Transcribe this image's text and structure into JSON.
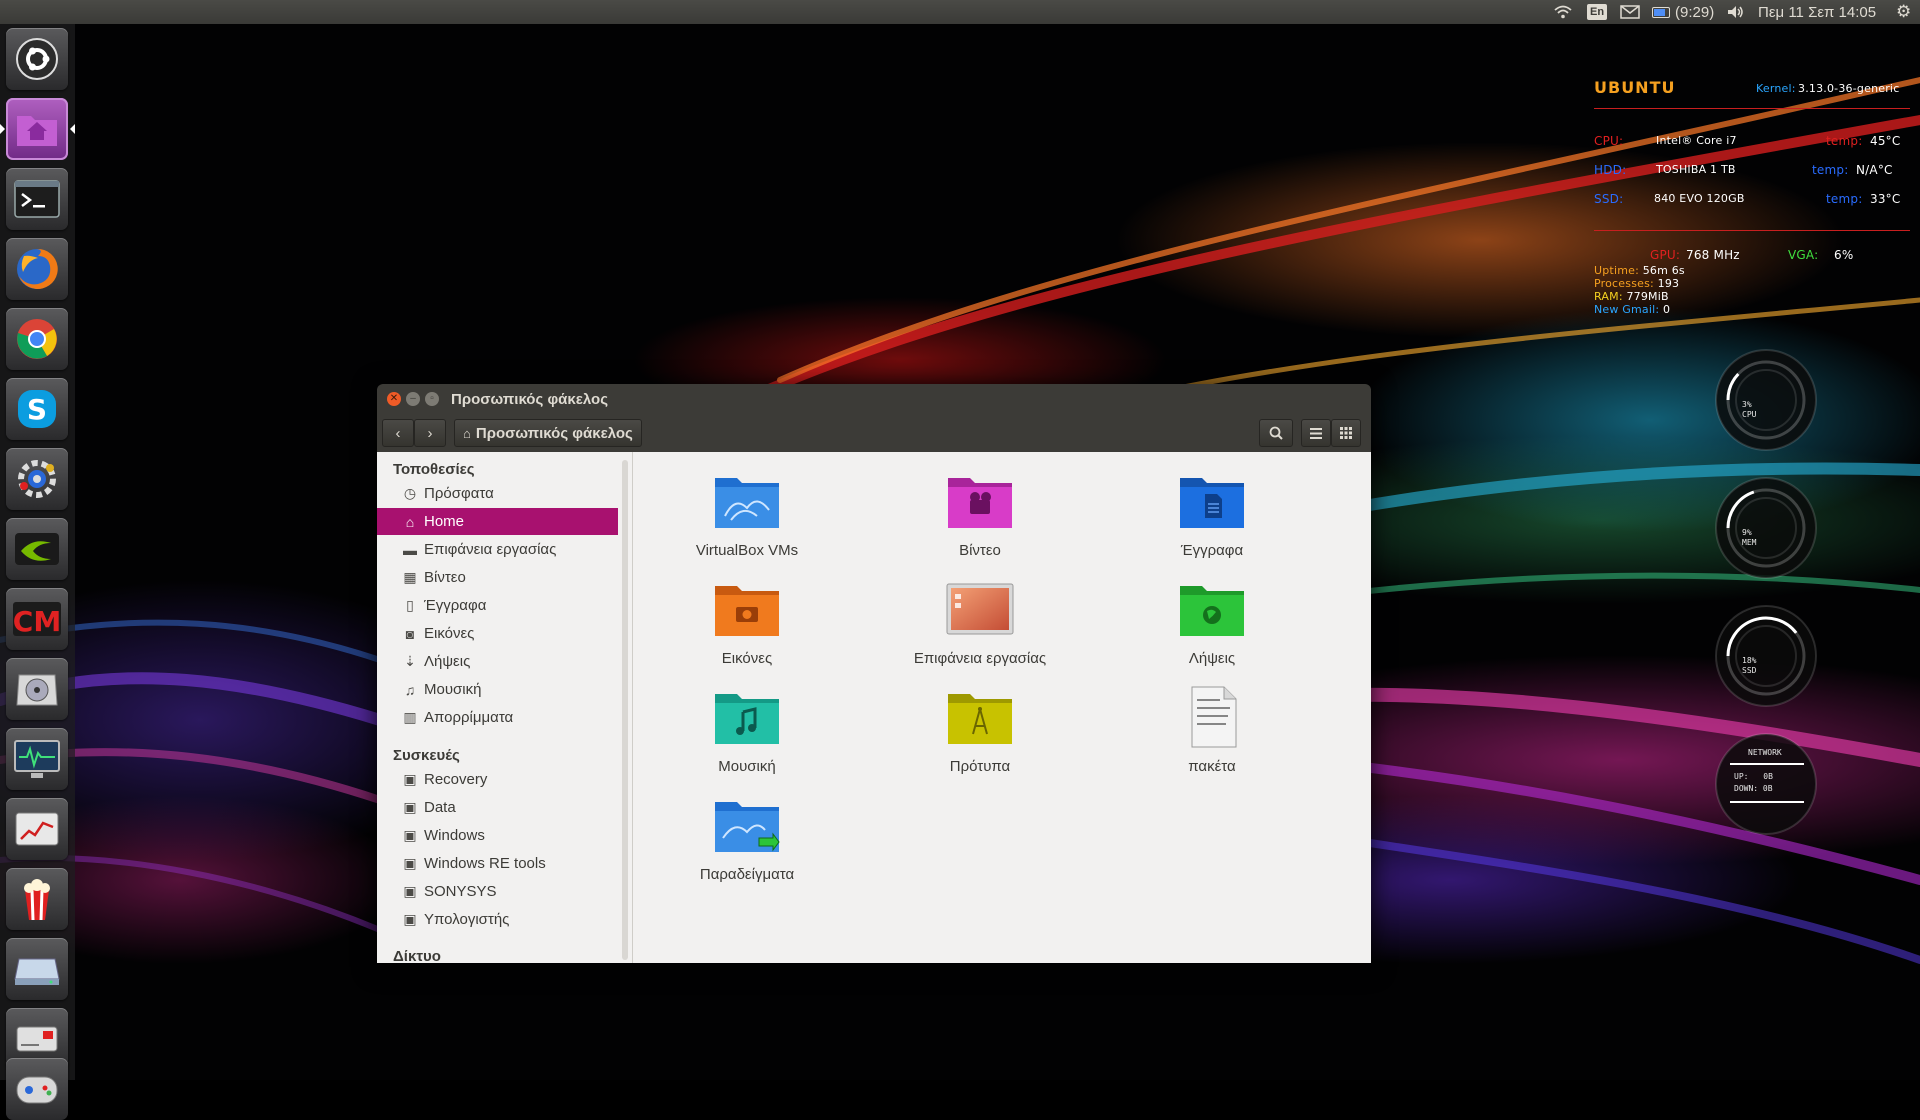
{
  "panel": {
    "keyboard_layout": "En",
    "battery_time": "(9:29)",
    "clock": "Πεμ 11 Σεπ 14:05"
  },
  "launcher": {
    "items": [
      {
        "name": "dash-home",
        "icon": "ubuntu-logo-icon"
      },
      {
        "name": "files",
        "icon": "home-folder-icon"
      },
      {
        "name": "terminal",
        "icon": "terminal-icon"
      },
      {
        "name": "firefox",
        "icon": "firefox-icon"
      },
      {
        "name": "chrome",
        "icon": "chrome-icon"
      },
      {
        "name": "skype",
        "icon": "skype-icon"
      },
      {
        "name": "system-settings",
        "icon": "settings-icon"
      },
      {
        "name": "nvidia-settings",
        "icon": "nvidia-icon"
      },
      {
        "name": "compizconfig",
        "icon": "ccsm-icon"
      },
      {
        "name": "disk-utility",
        "icon": "disk-icon"
      },
      {
        "name": "system-monitor",
        "icon": "monitor-icon"
      },
      {
        "name": "power-statistics",
        "icon": "chart-icon"
      },
      {
        "name": "popcorn-time",
        "icon": "popcorn-icon"
      },
      {
        "name": "disk-manager",
        "icon": "drive-icon"
      },
      {
        "name": "startup-disk",
        "icon": "usb-icon"
      },
      {
        "name": "games",
        "icon": "game-icon"
      }
    ]
  },
  "conky": {
    "os": "UBUNTU",
    "kernel_label": "Kernel:",
    "kernel_value": "3.13.0-36-generic",
    "cpu_label": "CPU:",
    "cpu_model": "Intel® Core i7",
    "cpu_temp_label": "temp:",
    "cpu_temp": "45°C",
    "hdd_label": "HDD:",
    "hdd_model": "TOSHIBA 1 TB",
    "hdd_temp_label": "temp:",
    "hdd_temp": "N/A°C",
    "ssd_label": "SSD:",
    "ssd_model": "840 EVO 120GB",
    "ssd_temp_label": "temp:",
    "ssd_temp": "33°C",
    "gpu_label": "GPU:",
    "gpu_value": "768 MHz",
    "vga_label": "VGA:",
    "vga_value": "6%",
    "uptime_label": "Uptime:",
    "uptime_value": "56m 6s",
    "processes_label": "Processes:",
    "processes_value": "193",
    "ram_label": "RAM:",
    "ram_value": "779MiB",
    "gmail_label": "New Gmail:",
    "gmail_value": "0",
    "gauges": [
      {
        "label": "CPU",
        "percent_text": "3%",
        "value": 0.03
      },
      {
        "label": "MEM",
        "percent_text": "9%",
        "value": 0.09
      },
      {
        "label": "SSD",
        "percent_text": "18%",
        "value": 0.18
      }
    ],
    "network": {
      "title": "NETWORK",
      "up_label": "UP:",
      "up_value": "0B",
      "down_label": "DOWN:",
      "down_value": "0B"
    }
  },
  "window": {
    "title": "Προσωπικός φάκελος",
    "breadcrumb": "Προσωπικός φάκελος"
  },
  "sidebar": {
    "places_heading": "Τοποθεσίες",
    "places": [
      {
        "label": "Πρόσφατα",
        "icon": "recent-icon"
      },
      {
        "label": "Home",
        "icon": "home-icon",
        "selected": true
      },
      {
        "label": "Επιφάνεια εργασίας",
        "icon": "desktop-icon"
      },
      {
        "label": "Βίντεο",
        "icon": "video-icon"
      },
      {
        "label": "Έγγραφα",
        "icon": "document-icon"
      },
      {
        "label": "Εικόνες",
        "icon": "camera-icon"
      },
      {
        "label": "Λήψεις",
        "icon": "download-icon"
      },
      {
        "label": "Μουσική",
        "icon": "music-icon"
      },
      {
        "label": "Απορρίμματα",
        "icon": "trash-icon"
      }
    ],
    "devices_heading": "Συσκευές",
    "devices": [
      {
        "label": "Recovery",
        "icon": "drive-icon"
      },
      {
        "label": "Data",
        "icon": "drive-icon"
      },
      {
        "label": "Windows",
        "icon": "drive-icon"
      },
      {
        "label": "Windows RE tools",
        "icon": "drive-icon"
      },
      {
        "label": "SONYSYS",
        "icon": "drive-icon"
      },
      {
        "label": "Υπολογιστής",
        "icon": "drive-icon"
      }
    ],
    "network_heading": "Δίκτυο"
  },
  "files": [
    {
      "label": "VirtualBox VMs",
      "icon": "folder-blue-icon",
      "color": "#3a8ee6"
    },
    {
      "label": "Βίντεο",
      "icon": "folder-video-icon",
      "color": "#d83cc8"
    },
    {
      "label": "Έγγραφα",
      "icon": "folder-documents-icon",
      "color": "#1c6fe0"
    },
    {
      "label": "Εικόνες",
      "icon": "folder-pictures-icon",
      "color": "#f07a1e"
    },
    {
      "label": "Επιφάνεια εργασίας",
      "icon": "folder-desktop-icon",
      "color": "#e0805a"
    },
    {
      "label": "Λήψεις",
      "icon": "folder-download-icon",
      "color": "#2cc43a"
    },
    {
      "label": "Μουσική",
      "icon": "folder-music-icon",
      "color": "#22bfa6"
    },
    {
      "label": "Πρότυπα",
      "icon": "folder-templates-icon",
      "color": "#c8c200"
    },
    {
      "label": "πακέτα",
      "icon": "text-file-icon",
      "color": "#e6e6e6"
    },
    {
      "label": "Παραδείγματα",
      "icon": "folder-examples-icon",
      "color": "#3a8ee6"
    }
  ]
}
